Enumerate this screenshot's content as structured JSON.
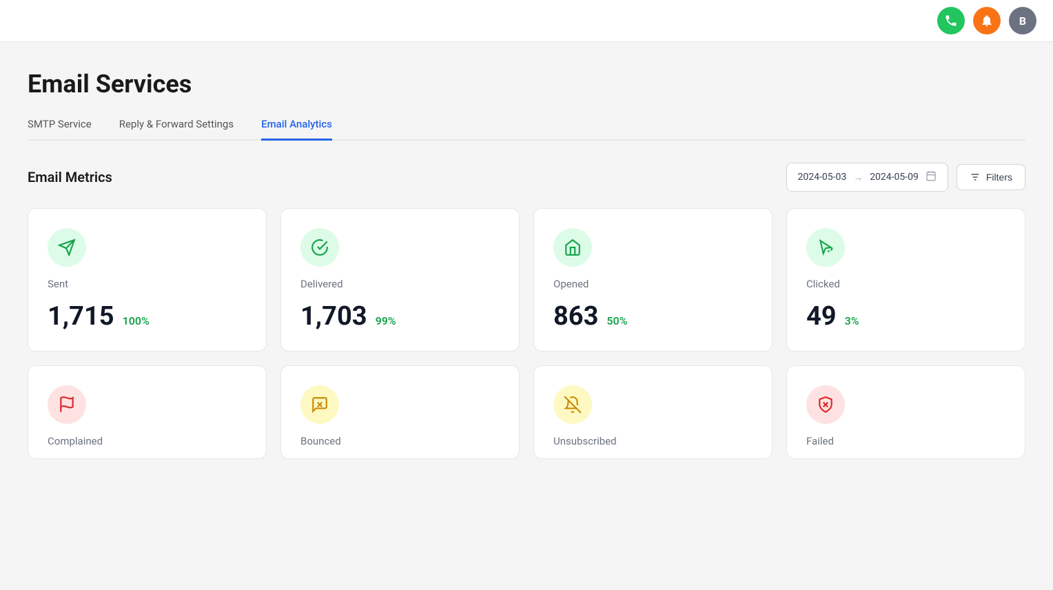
{
  "topbar": {
    "phone_icon": "📞",
    "bell_icon": "🔔",
    "user_icon": "B"
  },
  "page": {
    "title": "Email Services"
  },
  "tabs": [
    {
      "id": "smtp",
      "label": "SMTP Service",
      "active": false
    },
    {
      "id": "reply",
      "label": "Reply & Forward Settings",
      "active": false
    },
    {
      "id": "analytics",
      "label": "Email Analytics",
      "active": true
    }
  ],
  "metrics_section": {
    "title": "Email Metrics",
    "date_from": "2024-05-03",
    "date_to": "2024-05-09",
    "filters_label": "Filters"
  },
  "top_cards": [
    {
      "id": "sent",
      "label": "Sent",
      "value": "1,715",
      "pct": "100%",
      "icon_type": "send",
      "color": "green",
      "pct_color": "green"
    },
    {
      "id": "delivered",
      "label": "Delivered",
      "value": "1,703",
      "pct": "99%",
      "icon_type": "check",
      "color": "green",
      "pct_color": "green"
    },
    {
      "id": "opened",
      "label": "Opened",
      "value": "863",
      "pct": "50%",
      "icon_type": "envelope",
      "color": "green",
      "pct_color": "green"
    },
    {
      "id": "clicked",
      "label": "Clicked",
      "value": "49",
      "pct": "3%",
      "icon_type": "cursor",
      "color": "green",
      "pct_color": "green"
    }
  ],
  "bottom_cards": [
    {
      "id": "complained",
      "label": "Complained",
      "icon_type": "flag",
      "color": "red"
    },
    {
      "id": "bounced",
      "label": "Bounced",
      "icon_type": "message-x",
      "color": "yellow"
    },
    {
      "id": "unsubscribed",
      "label": "Unsubscribed",
      "icon_type": "bell-off",
      "color": "yellow"
    },
    {
      "id": "failed",
      "label": "Failed",
      "icon_type": "shield-x",
      "color": "red"
    }
  ]
}
